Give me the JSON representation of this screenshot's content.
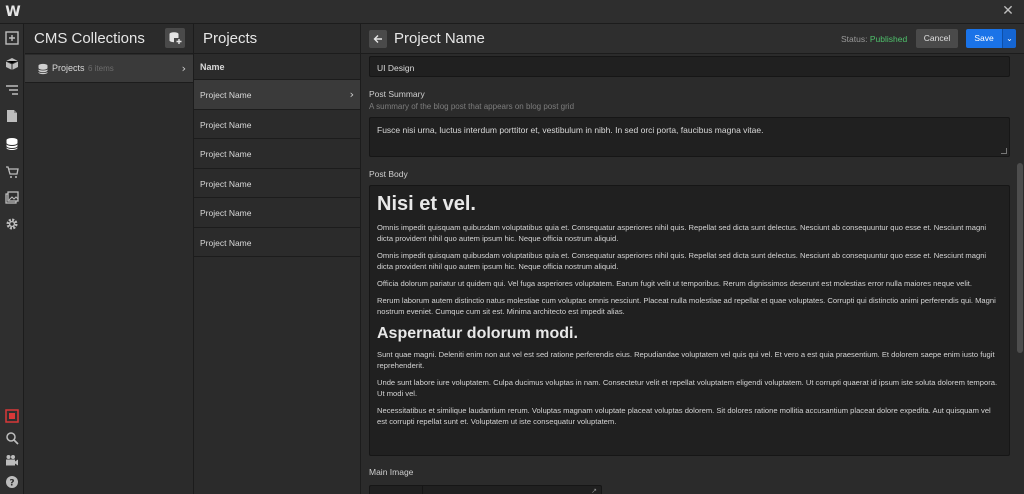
{
  "app": {
    "logo": "W",
    "close_glyph": "✕"
  },
  "rail": {
    "icons": [
      "add-icon",
      "box-icon",
      "navigator-icon",
      "pages-icon",
      "cms-icon",
      "ecommerce-icon",
      "assets-icon",
      "settings-icon",
      "record-icon",
      "search-icon",
      "video-icon",
      "help-icon"
    ],
    "active": "cms-icon"
  },
  "cms_panel": {
    "title": "CMS Collections",
    "items": [
      {
        "label": "Projects",
        "count": "6 items",
        "chevron": "›"
      }
    ]
  },
  "projects_panel": {
    "title": "Projects",
    "column_header": "Name",
    "rows": [
      {
        "name": "Project Name",
        "chevron": "›"
      },
      {
        "name": "Project Name"
      },
      {
        "name": "Project Name"
      },
      {
        "name": "Project Name"
      },
      {
        "name": "Project Name"
      },
      {
        "name": "Project Name"
      }
    ]
  },
  "editor": {
    "title": "Project Name",
    "status_label": "Status:",
    "status_value": "Published",
    "cancel_label": "Cancel",
    "save_label": "Save",
    "save_dropdown_glyph": "⌄",
    "fields": {
      "category_value": "UI Design",
      "post_summary": {
        "label": "Post Summary",
        "hint": "A summary of the blog post that appears on blog post grid",
        "value": "Fusce nisi urna, luctus interdum porttitor et, vestibulum in nibh. In sed orci porta, faucibus magna vitae."
      },
      "post_body": {
        "label": "Post Body",
        "heading1": "Nisi et vel.",
        "para1": "Omnis impedit quisquam quibusdam voluptatibus quia et. Consequatur asperiores nihil quis. Repellat sed dicta sunt delectus. Nesciunt ab consequuntur quo esse et. Nesciunt magni dicta provident nihil quo autem ipsum hic. Neque officia nostrum aliquid.",
        "para2": "Omnis impedit quisquam quibusdam voluptatibus quia et. Consequatur asperiores nihil quis. Repellat sed dicta sunt delectus. Nesciunt ab consequuntur quo esse et. Nesciunt magni dicta provident nihil quo autem ipsum hic. Neque officia nostrum aliquid.",
        "para3": "Officia dolorum pariatur ut quidem qui. Vel fuga asperiores voluptatem. Earum fugit velit ut temporibus. Rerum dignissimos deserunt est molestias error nulla maiores neque velit.",
        "para4": "Rerum laborum autem distinctio natus molestiae cum voluptas omnis nesciunt. Placeat nulla molestiae ad repellat et quae voluptates. Corrupti qui distinctio animi perferendis qui. Magni nostrum eveniet. Cumque cum sit est. Minima architecto est impedit alias.",
        "heading2": "Aspernatur dolorum modi.",
        "para5": "Sunt quae magni. Deleniti enim non aut vel est sed ratione perferendis eius. Repudiandae voluptatem vel quis qui vel. Et vero a est quia praesentium. Et dolorem saepe enim iusto fugit reprehenderit.",
        "para6": "Unde sunt labore iure voluptatem. Culpa ducimus voluptas in nam. Consectetur velit et repellat voluptatem eligendi voluptatem. Ut corrupti quaerat id ipsum iste soluta dolorem tempora. Ut modi vel.",
        "para7": "Necessitatibus et similique laudantium rerum. Voluptas magnam voluptate placeat voluptas dolorem. Sit dolores ratione mollitia accusantium placeat dolore expedita. Aut quisquam vel est corrupti repellat sunt et. Voluptatem ut iste consequatur voluptatem."
      },
      "main_image": {
        "label": "Main Image",
        "external_link_glyph": "↗"
      }
    }
  },
  "colors": {
    "accent_blue": "#1a73e8",
    "status_green": "#4ec06b",
    "record_red": "#d93838"
  }
}
